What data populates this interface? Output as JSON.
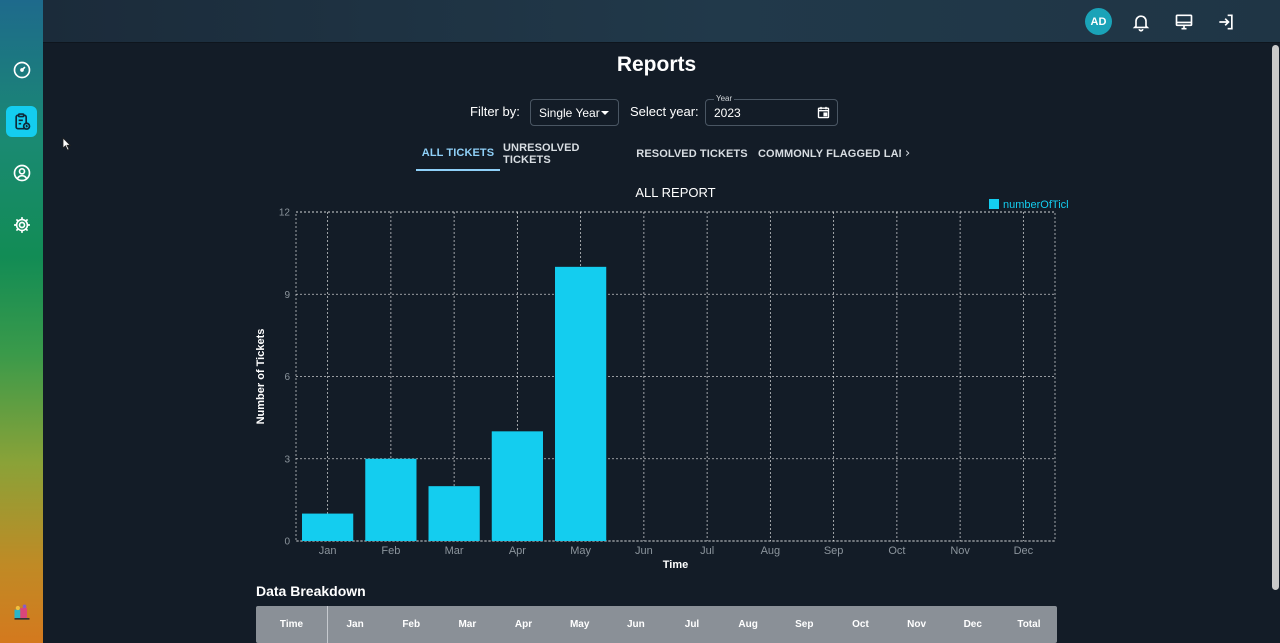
{
  "header": {
    "avatar_initials": "AD",
    "icons": [
      "bell-icon",
      "monitor-icon",
      "logout-icon"
    ]
  },
  "sidebar": {
    "items": [
      {
        "icon": "dashboard-gauge-icon"
      },
      {
        "icon": "reports-clipboard-icon",
        "active": true
      },
      {
        "icon": "user-profile-icon"
      },
      {
        "icon": "settings-gear-icon"
      },
      {
        "icon": "app-logo-icon"
      }
    ]
  },
  "page": {
    "title": "Reports"
  },
  "filters": {
    "filter_by_label": "Filter by:",
    "filter_value": "Single Year",
    "select_year_label": "Select year:",
    "year_field_label": "Year",
    "year_value": "2023"
  },
  "tabs": [
    {
      "label": "ALL TICKETS",
      "active": true
    },
    {
      "label": "UNRESOLVED TICKETS",
      "active": false
    },
    {
      "label": "RESOLVED TICKETS",
      "active": false
    },
    {
      "label": "COMMONLY FLAGGED LAN",
      "active": false
    }
  ],
  "colors": {
    "accent": "#14cdef",
    "bar": "#14cdef",
    "tab_active": "#8fd0f8",
    "background": "#131c27"
  },
  "chart_data": {
    "type": "bar",
    "title": "ALL REPORT",
    "xlabel": "Time",
    "ylabel": "Number of Tickets",
    "categories": [
      "Jan",
      "Feb",
      "Mar",
      "Apr",
      "May",
      "Jun",
      "Jul",
      "Aug",
      "Sep",
      "Oct",
      "Nov",
      "Dec"
    ],
    "series": [
      {
        "name": "numberOfTickets",
        "values": [
          1,
          3,
          2,
          4,
          10,
          0,
          0,
          0,
          0,
          0,
          0,
          0
        ]
      }
    ],
    "ylim": [
      0,
      12
    ],
    "yticks": [
      0,
      3,
      6,
      9,
      12
    ],
    "grid": true,
    "legend_position": "top-right"
  },
  "breakdown": {
    "title": "Data Breakdown",
    "columns": [
      "Time",
      "Jan",
      "Feb",
      "Mar",
      "Apr",
      "May",
      "Jun",
      "Jul",
      "Aug",
      "Sep",
      "Oct",
      "Nov",
      "Dec",
      "Total"
    ]
  }
}
